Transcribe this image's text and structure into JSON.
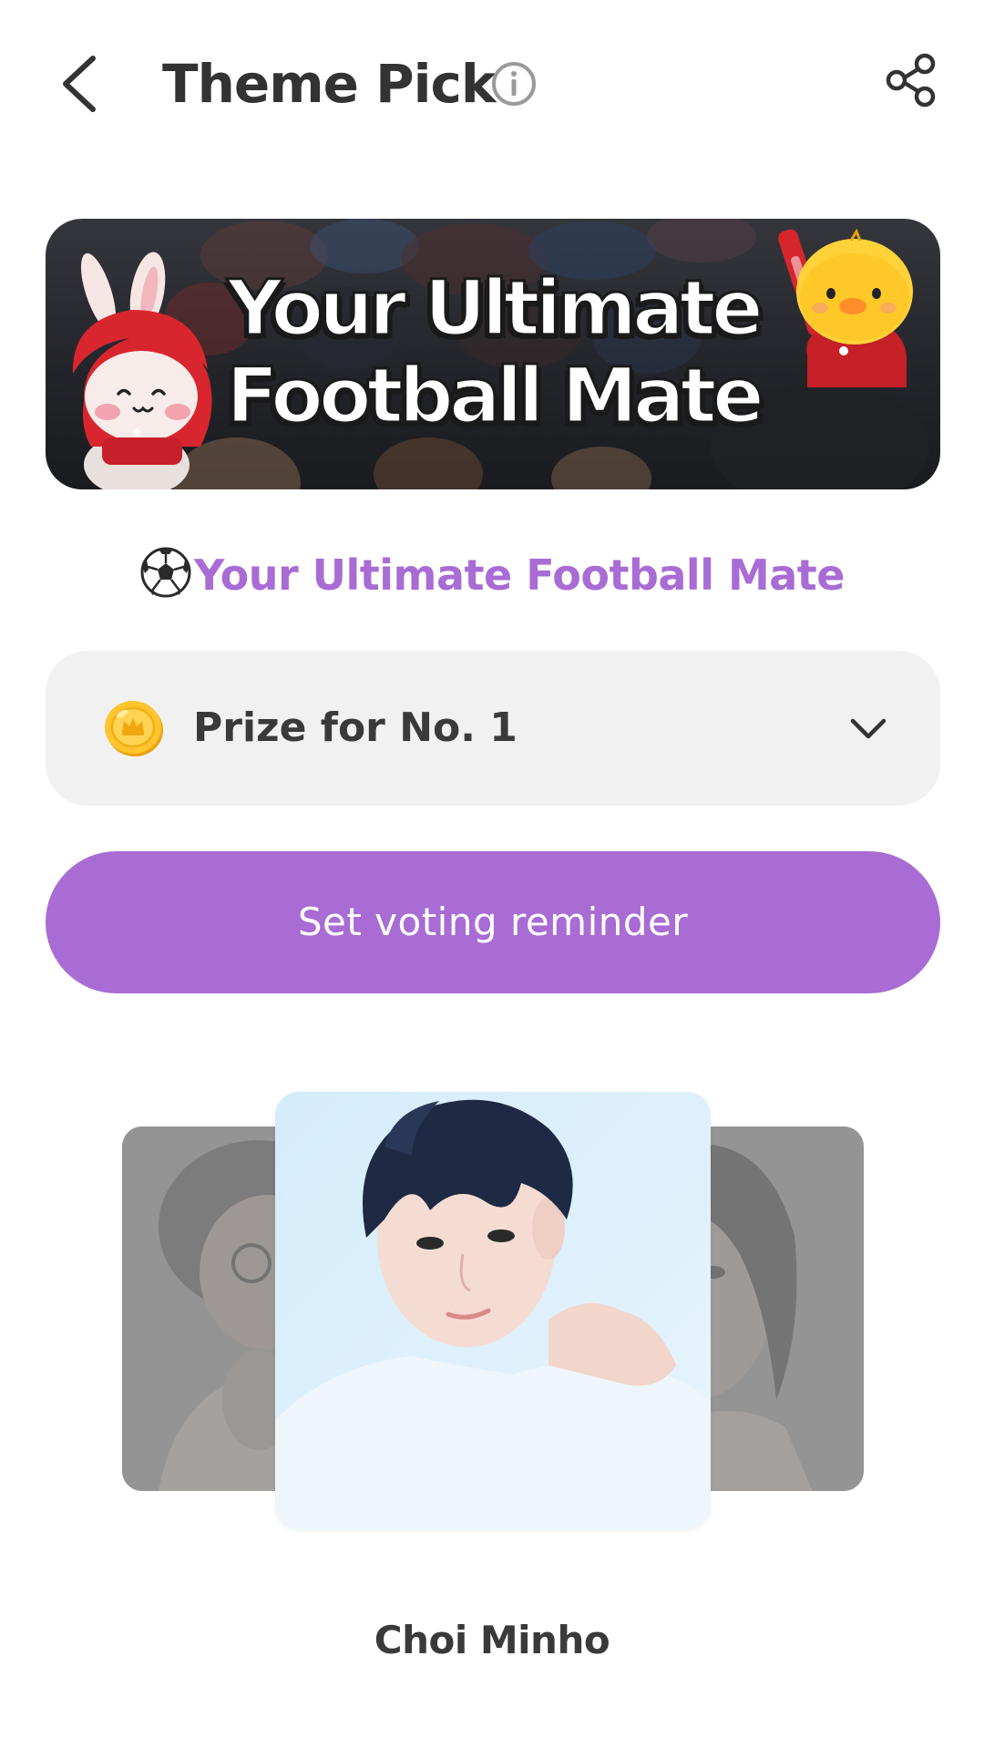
{
  "header": {
    "title": "Theme Pick",
    "back_icon": "chevron-left-icon",
    "info_icon": "info-icon",
    "share_icon": "share-icon"
  },
  "banner": {
    "line1": "Your Ultimate",
    "line2": "Football Mate"
  },
  "subtitle": {
    "emoji_icon": "soccer-ball-icon",
    "text": "Your Ultimate Football Mate"
  },
  "prize": {
    "icon": "coin-icon",
    "label": "Prize for No. 1",
    "expand_icon": "chevron-down-icon"
  },
  "reminder_button": {
    "label": "Set voting reminder"
  },
  "carousel": {
    "selected_name": "Choi Minho"
  },
  "colors": {
    "accent": "#a86cd4",
    "prize_bg": "#f1f1f1",
    "text": "#333333"
  }
}
